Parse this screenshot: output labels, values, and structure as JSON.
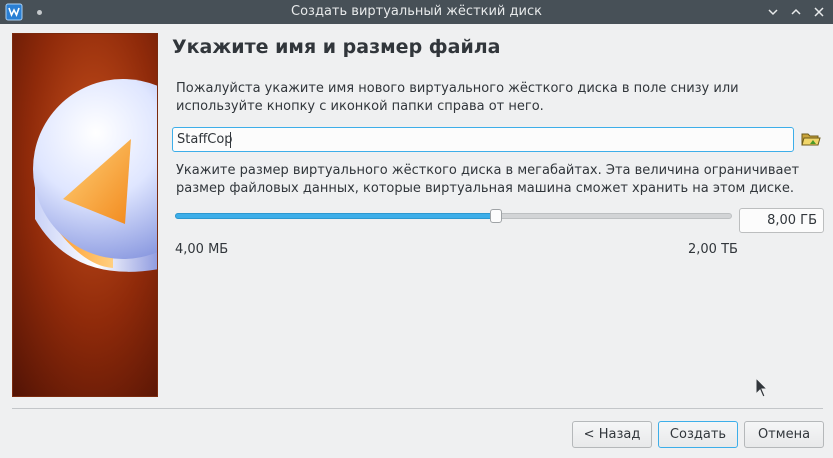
{
  "window": {
    "title": "Создать виртуальный жёсткий диск"
  },
  "page": {
    "heading": "Укажите имя и размер файла",
    "name_description": "Пожалуйста укажите имя нового виртуального жёсткого диска в поле снизу или используйте кнопку с иконкой папки справа от него.",
    "size_description": "Укажите размер виртуального жёсткого диска в мегабайтах. Эта величина ограничивает размер файловых данных, которые виртуальная машина сможет хранить на этом диске."
  },
  "file_name": {
    "value": "StaffCop"
  },
  "size": {
    "value_label": "8,00 ГБ",
    "slider_fraction": 0.576,
    "min_label": "4,00 МБ",
    "max_label": "2,00 ТБ"
  },
  "buttons": {
    "back": "< Назад",
    "create": "Создать",
    "cancel": "Отмена"
  },
  "icons": {
    "app": "virtualbox-icon",
    "folder": "folder-open-icon",
    "minimize": "minimize-icon",
    "maximize": "maximize-icon",
    "close": "close-icon"
  },
  "colors": {
    "titlebar": "#475057",
    "accent": "#3daee9",
    "side_panel_dark": "#5a1505",
    "side_panel_light": "#b23a12"
  }
}
